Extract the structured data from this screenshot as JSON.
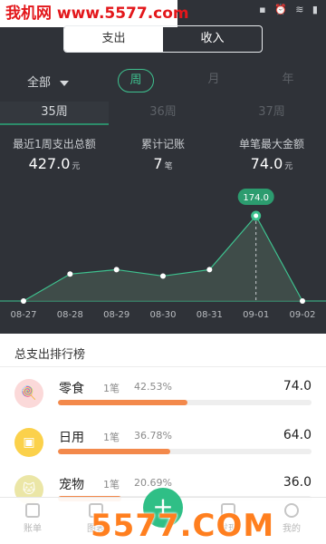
{
  "watermark_top": "我机网 www.5577.com",
  "watermark_bottom": "5577.COM",
  "status_icons": "▪ ⏰ ≋ ▮",
  "segment": {
    "expense": "支出",
    "income": "收入"
  },
  "filter": {
    "all": "全部",
    "periods": [
      "周",
      "月",
      "年"
    ],
    "active_period": "周"
  },
  "week_tabs": [
    "35周",
    "36周",
    "37周"
  ],
  "stats": [
    {
      "label": "最近1周支出总额",
      "value": "427.0",
      "unit": "元"
    },
    {
      "label": "累计记账",
      "value": "7",
      "unit": "笔"
    },
    {
      "label": "单笔最大金额",
      "value": "74.0",
      "unit": "元"
    }
  ],
  "chart_data": {
    "type": "area",
    "categories": [
      "08-27",
      "08-28",
      "08-29",
      "08-30",
      "08-31",
      "09-01",
      "09-02"
    ],
    "values": [
      0,
      55,
      64,
      51,
      64,
      174,
      0
    ],
    "highlight_index": 5,
    "highlight_label": "174.0",
    "colors": {
      "line": "#3ec28f",
      "fill": "#46564f",
      "marker": "#ffffff",
      "badge": "#2c9c6f"
    }
  },
  "ranking": {
    "title": "总支出排行榜",
    "items": [
      {
        "name": "零食",
        "count": "1笔",
        "percent": "42.53%",
        "amount": "74.0",
        "share": 0.4253,
        "icon": "lollipop-icon",
        "color": "#fbd9d9",
        "glyph": "🍭"
      },
      {
        "name": "日用",
        "count": "1笔",
        "percent": "36.78%",
        "amount": "64.0",
        "share": 0.3678,
        "icon": "daily-goods-icon",
        "color": "#fbd14b",
        "glyph": "▣"
      },
      {
        "name": "宠物",
        "count": "1笔",
        "percent": "20.69%",
        "amount": "36.0",
        "share": 0.2069,
        "icon": "pet-icon",
        "color": "#ebe6a6",
        "glyph": "🐱"
      }
    ]
  },
  "tabbar": {
    "items": [
      "账单",
      "图表",
      "",
      "发现",
      "我的"
    ],
    "add_label": "+"
  }
}
